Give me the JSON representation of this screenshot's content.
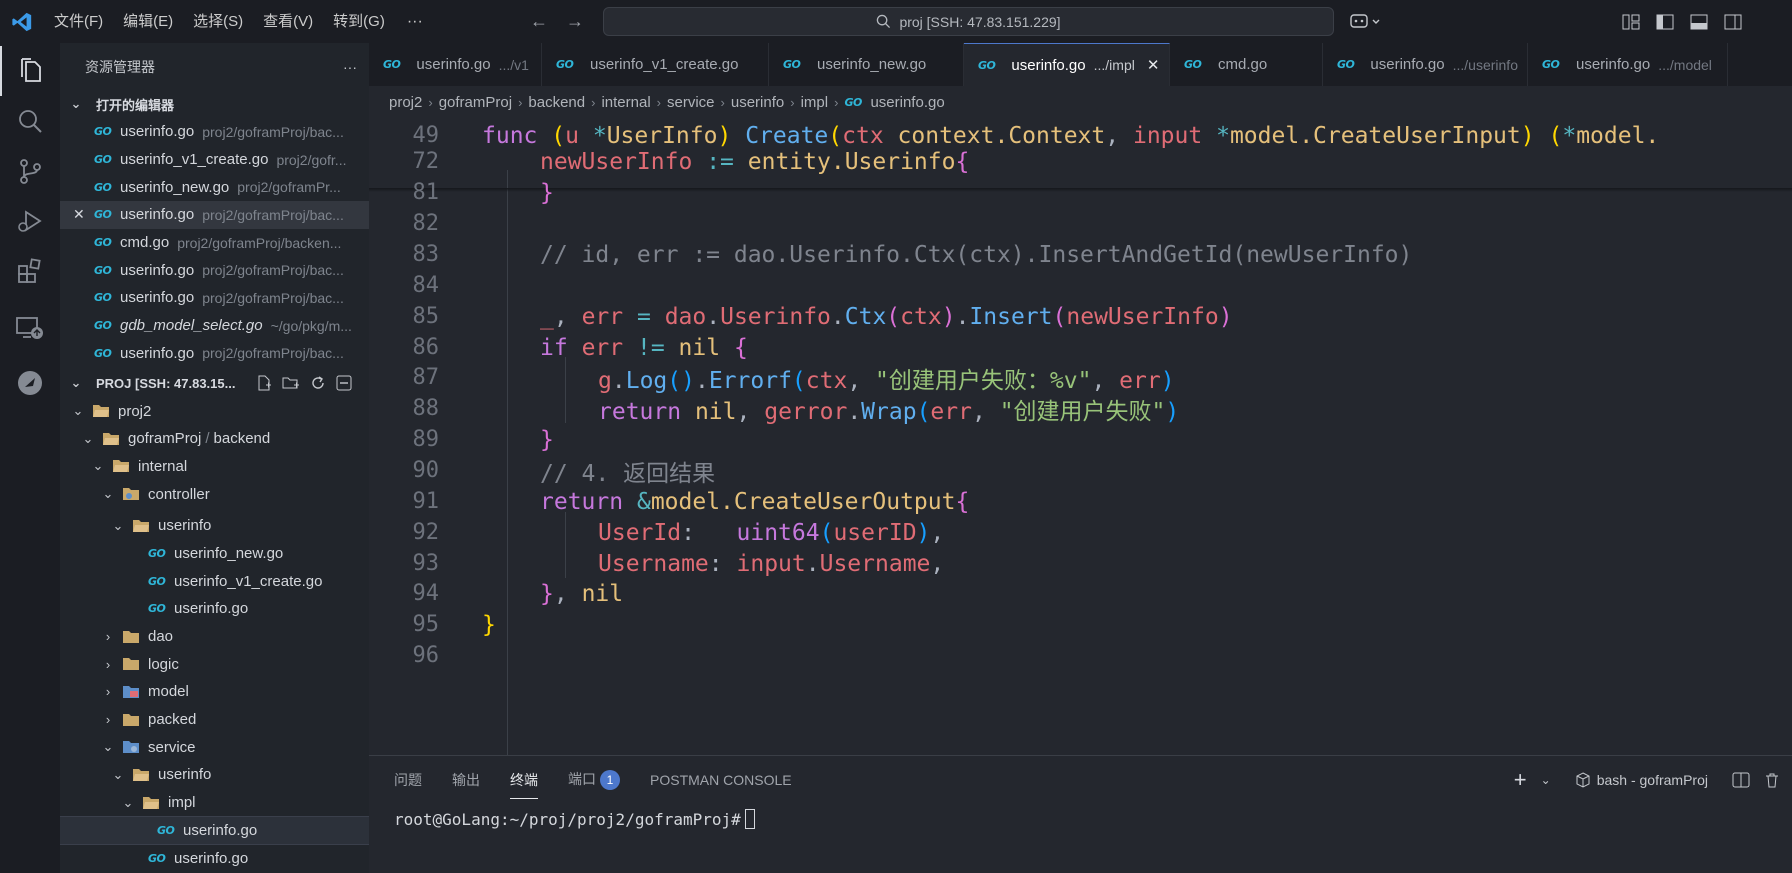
{
  "menu": [
    "文件(F)",
    "编辑(E)",
    "选择(S)",
    "查看(V)",
    "转到(G)"
  ],
  "menu_more": "···",
  "command_center": "proj [SSH: 47.83.151.229]",
  "sidebar": {
    "title": "资源管理器",
    "more": "···",
    "open_editors_label": "打开的编辑器",
    "open_editors": [
      {
        "name": "userinfo.go",
        "desc": "proj2/goframProj/bac..."
      },
      {
        "name": "userinfo_v1_create.go",
        "desc": "proj2/gofr..."
      },
      {
        "name": "userinfo_new.go",
        "desc": "proj2/goframPr..."
      },
      {
        "name": "userinfo.go",
        "desc": "proj2/goframProj/bac..."
      },
      {
        "name": "cmd.go",
        "desc": "proj2/goframProj/backen..."
      },
      {
        "name": "userinfo.go",
        "desc": "proj2/goframProj/bac..."
      },
      {
        "name": "userinfo.go",
        "desc": "proj2/goframProj/bac..."
      },
      {
        "name": "gdb_model_select.go",
        "desc": "~/go/pkg/m..."
      },
      {
        "name": "userinfo.go",
        "desc": "proj2/goframProj/bac..."
      }
    ],
    "workspace_label": "PROJ [SSH: 47.83.15...",
    "tree": {
      "proj2": "proj2",
      "goframProj": "goframProj",
      "backend": "backend",
      "internal": "internal",
      "controller": "controller",
      "ctrl_userinfo": "userinfo",
      "userinfo_new": "userinfo_new.go",
      "userinfo_v1_create": "userinfo_v1_create.go",
      "ctrl_userinfo_go": "userinfo.go",
      "dao": "dao",
      "logic": "logic",
      "model": "model",
      "packed": "packed",
      "service": "service",
      "svc_userinfo": "userinfo",
      "impl": "impl",
      "impl_userinfo_go": "userinfo.go",
      "svc_userinfo_go": "userinfo.go"
    }
  },
  "tabs": [
    {
      "name": "userinfo.go",
      "desc": ".../v1"
    },
    {
      "name": "userinfo_v1_create.go",
      "desc": ""
    },
    {
      "name": "userinfo_new.go",
      "desc": ""
    },
    {
      "name": "userinfo.go",
      "desc": ".../impl"
    },
    {
      "name": "cmd.go",
      "desc": ""
    },
    {
      "name": "userinfo.go",
      "desc": ".../userinfo"
    },
    {
      "name": "userinfo.go",
      "desc": ".../model"
    }
  ],
  "breadcrumb": [
    "proj2",
    "goframProj",
    "backend",
    "internal",
    "service",
    "userinfo",
    "impl",
    "userinfo.go"
  ],
  "code": {
    "line_numbers": [
      "49",
      "72",
      "81",
      "82",
      "83",
      "84",
      "85",
      "86",
      "87",
      "88",
      "89",
      "90",
      "91",
      "92",
      "93",
      "94",
      "95",
      "96"
    ],
    "l49": {
      "kw": "func",
      "recv_open": "(",
      "recv_name": "u",
      "recv_star": "*",
      "recv_type": "UserInfo",
      "recv_close": ")",
      "fn": "Create",
      "p_open": "(",
      "p1": "ctx",
      "p1_type": "context.Context",
      "comma": ",",
      "p2": "input",
      "p2_star": "*",
      "p2_type": "model.CreateUserInput",
      "p_close": ")",
      "ret_open": "(",
      "ret_star": "*",
      "ret_type": "model."
    },
    "l72": {
      "var": "newUserInfo",
      "op": ":=",
      "pkg": "entity.",
      "type": "Userinfo",
      "brace": "{"
    },
    "l81": "}",
    "l83": "// id, err := dao.Userinfo.Ctx(ctx).InsertAndGetId(newUserInfo)",
    "l85": {
      "blank": "_",
      "c1": ",",
      "err": "err",
      "eq": "=",
      "dao": "dao",
      "dot1": ".",
      "userinfo": "Userinfo",
      "dot2": ".",
      "ctxfn": "Ctx",
      "po": "(",
      "ctx": "ctx",
      "pc": ")",
      "dot3": ".",
      "insert": "Insert",
      "po2": "(",
      "arg": "newUserInfo",
      "pc2": ")"
    },
    "l86": {
      "kw": "if",
      "err": "err",
      "op": "!=",
      "nil": "nil",
      "brace": "{"
    },
    "l87": {
      "g": "g",
      "dot": ".",
      "log": "Log",
      "p": "()",
      "dot2": ".",
      "errorf": "Errorf",
      "po": "(",
      "ctx": "ctx",
      "c": ",",
      "str": "\"创建用户失败：%v\"",
      "c2": ",",
      "err": "err",
      "pc": ")"
    },
    "l88": {
      "kw": "return",
      "nil": "nil",
      "c": ",",
      "pkg": "gerror",
      "dot": ".",
      "wrap": "Wrap",
      "po": "(",
      "err": "err",
      "c2": ",",
      "str": "\"创建用户失败\"",
      "pc": ")"
    },
    "l89": "}",
    "l90": "// 4. 返回结果",
    "l91": {
      "kw": "return",
      "amp": "&",
      "pkg": "model.",
      "type": "CreateUserOutput",
      "brace": "{"
    },
    "l92": {
      "field": "UserId",
      "colon": ":",
      "fn": "uint64",
      "po": "(",
      "arg": "userID",
      "pc": ")",
      "comma": ","
    },
    "l93": {
      "field": "Username",
      "colon": ":",
      "obj": "input",
      "dot": ".",
      "prop": "Username",
      "comma": ","
    },
    "l94": {
      "brace": "}",
      "comma": ",",
      "nil": "nil"
    },
    "l95": "}"
  },
  "panel": {
    "tabs": [
      "问题",
      "输出",
      "终端",
      "端口"
    ],
    "ports_badge": "1",
    "postman": "POSTMAN CONSOLE",
    "plus": "+",
    "terminal_name": "bash - goframProj",
    "prompt": "root@GoLang:~/proj/proj2/goframProj#"
  },
  "colors": {
    "accent": "#4d78cc",
    "go_icon": "#2fb6d8",
    "folder": "#c9a86a"
  }
}
